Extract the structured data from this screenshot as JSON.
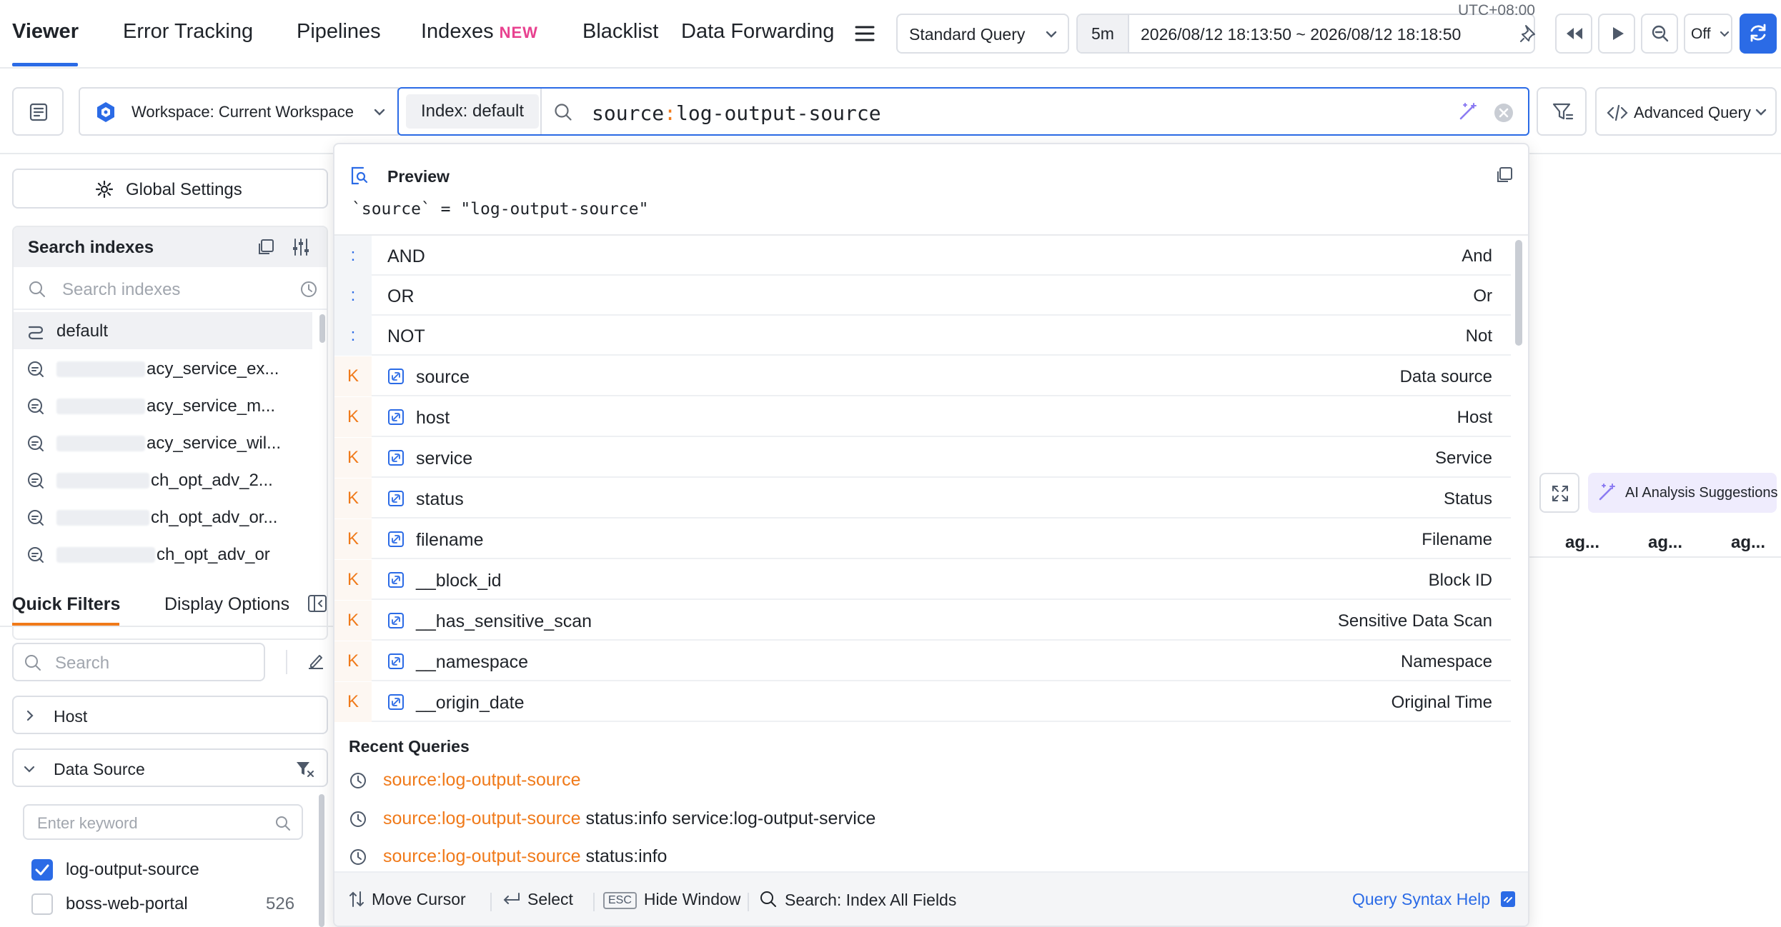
{
  "topnav": {
    "tabs": [
      {
        "label": "Viewer",
        "active": true
      },
      {
        "label": "Error Tracking"
      },
      {
        "label": "Pipelines"
      },
      {
        "label": "Indexes",
        "badge": "NEW"
      },
      {
        "label": "Blacklist"
      },
      {
        "label": "Data Forwarding"
      }
    ],
    "query_mode": "Standard Query",
    "time_range_short": "5m",
    "time_range": "2026/08/12 18:13:50 ~ 2026/08/12 18:18:50",
    "timezone": "UTC+08:00",
    "refresh_setting": "Off"
  },
  "querybar": {
    "workspace": "Workspace: Current Workspace",
    "index_chip": "Index: default",
    "query_key": "source",
    "query_sep": ":",
    "query_value": "log-output-source",
    "advanced_query": "Advanced Query"
  },
  "sidebar": {
    "global_settings": "Global Settings",
    "search_indexes_title": "Search indexes",
    "search_indexes_placeholder": "Search indexes",
    "indexes": [
      {
        "label": "default",
        "selected": true
      },
      {
        "label": "acy_service_ex..."
      },
      {
        "label": "acy_service_m..."
      },
      {
        "label": "acy_service_wil..."
      },
      {
        "label": "ch_opt_adv_2..."
      },
      {
        "label": "ch_opt_adv_or..."
      },
      {
        "label": "ch_opt_adv_or"
      }
    ],
    "tabs": {
      "quick_filters": "Quick Filters",
      "display_options": "Display Options"
    },
    "filter_search_placeholder": "Search",
    "host_group": "Host",
    "data_source_group": "Data Source",
    "keyword_placeholder": "Enter keyword",
    "sources": [
      {
        "label": "log-output-source",
        "checked": true,
        "count": ""
      },
      {
        "label": "boss-web-portal",
        "checked": false,
        "count": "526"
      }
    ]
  },
  "dropdown": {
    "preview_title": "Preview",
    "preview_text": "`source` = \"log-output-source\"",
    "operators": [
      {
        "type": ":",
        "name": "AND",
        "desc": "And"
      },
      {
        "type": ":",
        "name": "OR",
        "desc": "Or"
      },
      {
        "type": ":",
        "name": "NOT",
        "desc": "Not"
      }
    ],
    "fields": [
      {
        "type": "K",
        "name": "source",
        "desc": "Data source"
      },
      {
        "type": "K",
        "name": "host",
        "desc": "Host"
      },
      {
        "type": "K",
        "name": "service",
        "desc": "Service"
      },
      {
        "type": "K",
        "name": "status",
        "desc": "Status"
      },
      {
        "type": "K",
        "name": "filename",
        "desc": "Filename"
      },
      {
        "type": "K",
        "name": "__block_id",
        "desc": "Block ID"
      },
      {
        "type": "K",
        "name": "__has_sensitive_scan",
        "desc": "Sensitive Data Scan"
      },
      {
        "type": "K",
        "name": "__namespace",
        "desc": "Namespace"
      },
      {
        "type": "K",
        "name": "__origin_date",
        "desc": "Original Time"
      }
    ],
    "recent_title": "Recent Queries",
    "recent": [
      {
        "highlight": "source:log-output-source",
        "rest": ""
      },
      {
        "highlight": "source:log-output-source",
        "rest": " status:info service:log-output-service"
      },
      {
        "highlight": "source:log-output-source",
        "rest": " status:info"
      }
    ],
    "footer": {
      "move_cursor": "Move Cursor",
      "select": "Select",
      "esc_key": "ESC",
      "hide_window": "Hide Window",
      "search_all": "Search: Index All Fields",
      "syntax_help": "Query Syntax Help"
    }
  },
  "main": {
    "ai_button": "AI Analysis Suggestions",
    "columns": [
      "ag...",
      "ag...",
      "ag..."
    ]
  },
  "colors": {
    "accent": "#2b6be6",
    "orange": "#f07a1a",
    "badge_pink": "#e8418f",
    "ai_bg": "#efecfd"
  }
}
